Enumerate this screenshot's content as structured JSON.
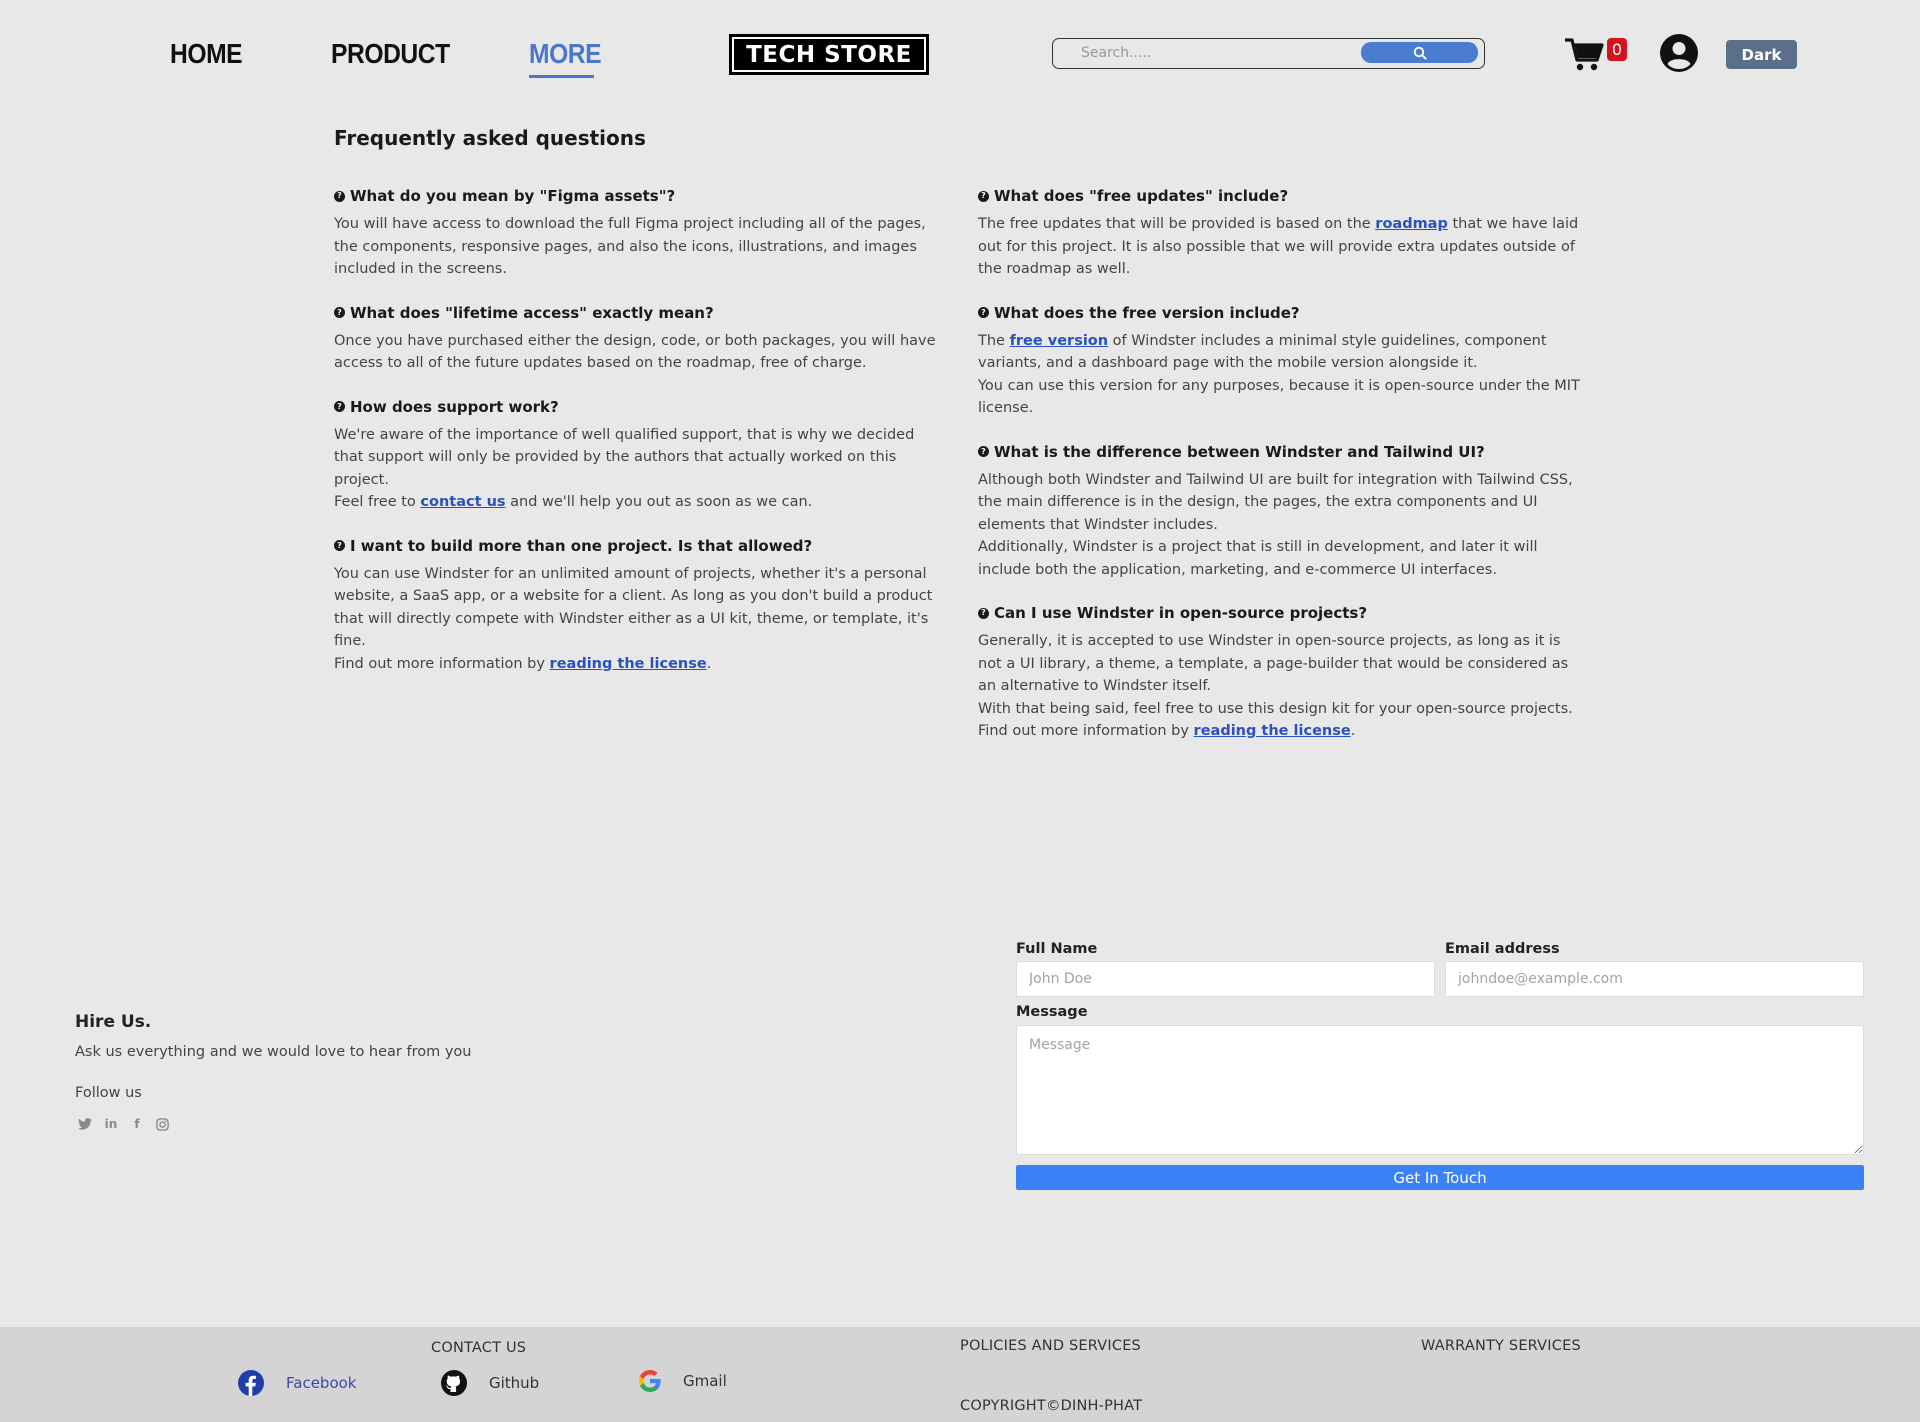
{
  "header": {
    "nav": {
      "home": "HOME",
      "product": "PRODUCT",
      "more": "MORE"
    },
    "logo": "TECH STORE",
    "search": {
      "placeholder": "Search.....",
      "icon": "search-icon"
    },
    "cart": {
      "count": "0",
      "icon": "cart-icon"
    },
    "avatar_icon": "user-circle-icon",
    "theme_button": "Dark",
    "colors": {
      "active_nav": "#4a78c8",
      "search_button": "#4a7cd0",
      "badge": "#d4141c",
      "theme_button": "#5c6f8a"
    }
  },
  "faq": {
    "title": "Frequently asked questions",
    "left": [
      {
        "q": "What do you mean by \"Figma assets\"?",
        "a": "You will have access to download the full Figma project including all of the pages, the components, responsive pages, and also the icons, illustrations, and images included in the screens."
      },
      {
        "q": "What does \"lifetime access\" exactly mean?",
        "a": "Once you have purchased either the design, code, or both packages, you will have access to all of the future updates based on the roadmap, free of charge."
      },
      {
        "q": "How does support work?",
        "a1": "We're aware of the importance of well qualified support, that is why we decided that support will only be provided by the authors that actually worked on this project.",
        "a2_pre": "Feel free to ",
        "a2_link": "contact us",
        "a2_post": " and we'll help you out as soon as we can."
      },
      {
        "q": "I want to build more than one project. Is that allowed?",
        "a1": "You can use Windster for an unlimited amount of projects, whether it's a personal website, a SaaS app, or a website for a client. As long as you don't build a product that will directly compete with Windster either as a UI kit, theme, or template, it's fine.",
        "a2_pre": "Find out more information by ",
        "a2_link": "reading the license",
        "a2_post": "."
      }
    ],
    "right": [
      {
        "q": "What does \"free updates\" include?",
        "a_pre": "The free updates that will be provided is based on the ",
        "a_link": "roadmap",
        "a_post": " that we have laid out for this project. It is also possible that we will provide extra updates outside of the roadmap as well."
      },
      {
        "q": "What does the free version include?",
        "a_pre": "The ",
        "a_link": "free version",
        "a_post": " of Windster includes a minimal style guidelines, component variants, and a dashboard page with the mobile version alongside it.",
        "a2": "You can use this version for any purposes, because it is open-source under the MIT license."
      },
      {
        "q": "What is the difference between Windster and Tailwind UI?",
        "a1": "Although both Windster and Tailwind UI are built for integration with Tailwind CSS, the main difference is in the design, the pages, the extra components and UI elements that Windster includes.",
        "a2": "Additionally, Windster is a project that is still in development, and later it will include both the application, marketing, and e-commerce UI interfaces."
      },
      {
        "q": "Can I use Windster in open-source projects?",
        "a1": "Generally, it is accepted to use Windster in open-source projects, as long as it is not a UI library, a theme, a template, a page-builder that would be considered as an alternative to Windster itself.",
        "a2": "With that being said, feel free to use this design kit for your open-source projects.",
        "a3_pre": "Find out more information by ",
        "a3_link": "reading the license",
        "a3_post": "."
      }
    ]
  },
  "hire": {
    "title": "Hire Us.",
    "subtitle": "Ask us everything and we would love to hear from you",
    "follow": "Follow us",
    "social_icons": [
      "twitter-icon",
      "linkedin-icon",
      "facebook-icon",
      "instagram-icon"
    ]
  },
  "form": {
    "full_name_label": "Full Name",
    "full_name_placeholder": "John Doe",
    "email_label": "Email address",
    "email_placeholder": "johndoe@example.com",
    "message_label": "Message",
    "message_placeholder": "Message",
    "submit": "Get In Touch",
    "submit_color": "#3b82f6"
  },
  "footer": {
    "contact_heading": "CONTACT US",
    "links": [
      {
        "label": "Facebook",
        "icon": "facebook-icon"
      },
      {
        "label": "Github",
        "icon": "github-icon"
      },
      {
        "label": "Gmail",
        "icon": "google-icon"
      }
    ],
    "policies": "POLICIES AND SERVICES",
    "warranty": "WARRANTY SERVICES",
    "copyright": "COPYRIGHT©DINH-PHAT"
  }
}
